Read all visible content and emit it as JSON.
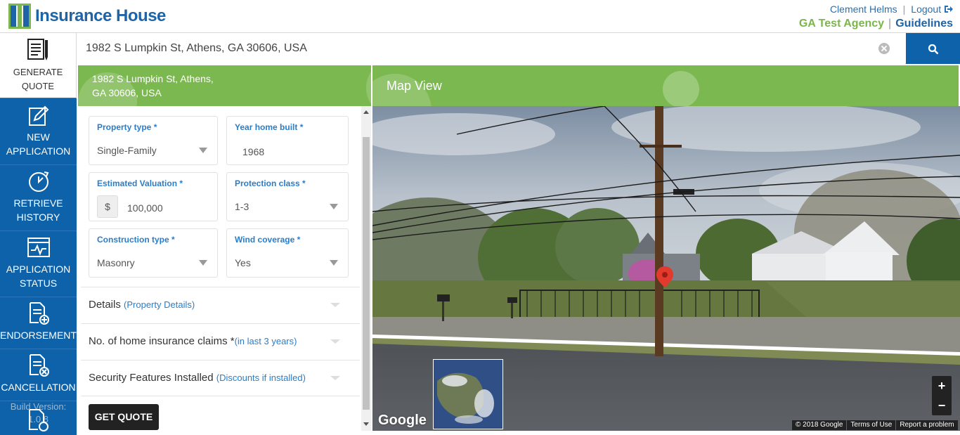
{
  "header": {
    "logo_text": "Insurance House",
    "user_name": "Clement Helms",
    "logout": "Logout",
    "agency": "GA Test Agency",
    "guidelines": "Guidelines"
  },
  "sidebar": {
    "items": [
      {
        "label_line1": "GENERATE",
        "label_line2": "QUOTE",
        "icon": "document-list-icon"
      },
      {
        "label_line1": "NEW",
        "label_line2": "APPLICATION",
        "icon": "pencil-document-icon"
      },
      {
        "label_line1": "RETRIEVE",
        "label_line2": "HISTORY",
        "icon": "history-clock-icon"
      },
      {
        "label_line1": "APPLICATION",
        "label_line2": "STATUS",
        "icon": "status-monitor-icon"
      },
      {
        "label_line1": "ENDORSEMENT",
        "label_line2": "",
        "icon": "document-plus-icon"
      },
      {
        "label_line1": "CANCELLATION",
        "label_line2": "",
        "icon": "document-cancel-icon"
      }
    ],
    "build_label": "Build Version:",
    "build_value": "1.0.8"
  },
  "search": {
    "value": "1982 S Lumpkin St, Athens, GA 30606, USA"
  },
  "address_panel": {
    "line1": "1982 S Lumpkin St, Athens,",
    "line2": "GA 30606, USA"
  },
  "form": {
    "property_type": {
      "label": "Property type *",
      "value": "Single-Family"
    },
    "year_built": {
      "label": "Year home built *",
      "value": "1968"
    },
    "valuation": {
      "label": "Estimated Valuation *",
      "prefix": "$",
      "value": "100,000"
    },
    "protection_class": {
      "label": "Protection class *",
      "value": "1-3"
    },
    "construction_type": {
      "label": "Construction type *",
      "value": "Masonry"
    },
    "wind_coverage": {
      "label": "Wind coverage *",
      "value": "Yes"
    }
  },
  "accordions": [
    {
      "title": "Details",
      "sub": "(Property Details)"
    },
    {
      "title": "No. of home insurance claims *",
      "sub": "(in last 3 years)"
    },
    {
      "title": "Security Features Installed",
      "sub": "(Discounts if installed)"
    }
  ],
  "get_quote": "GET QUOTE",
  "map": {
    "title": "Map View",
    "google": "Google",
    "zoom_in": "+",
    "zoom_out": "−",
    "attribution": [
      "© 2018 Google",
      "Terms of Use",
      "Report a problem"
    ]
  },
  "colors": {
    "brand_blue": "#0e62a9",
    "brand_green": "#7bb84f",
    "label_blue": "#2a7dc8"
  }
}
